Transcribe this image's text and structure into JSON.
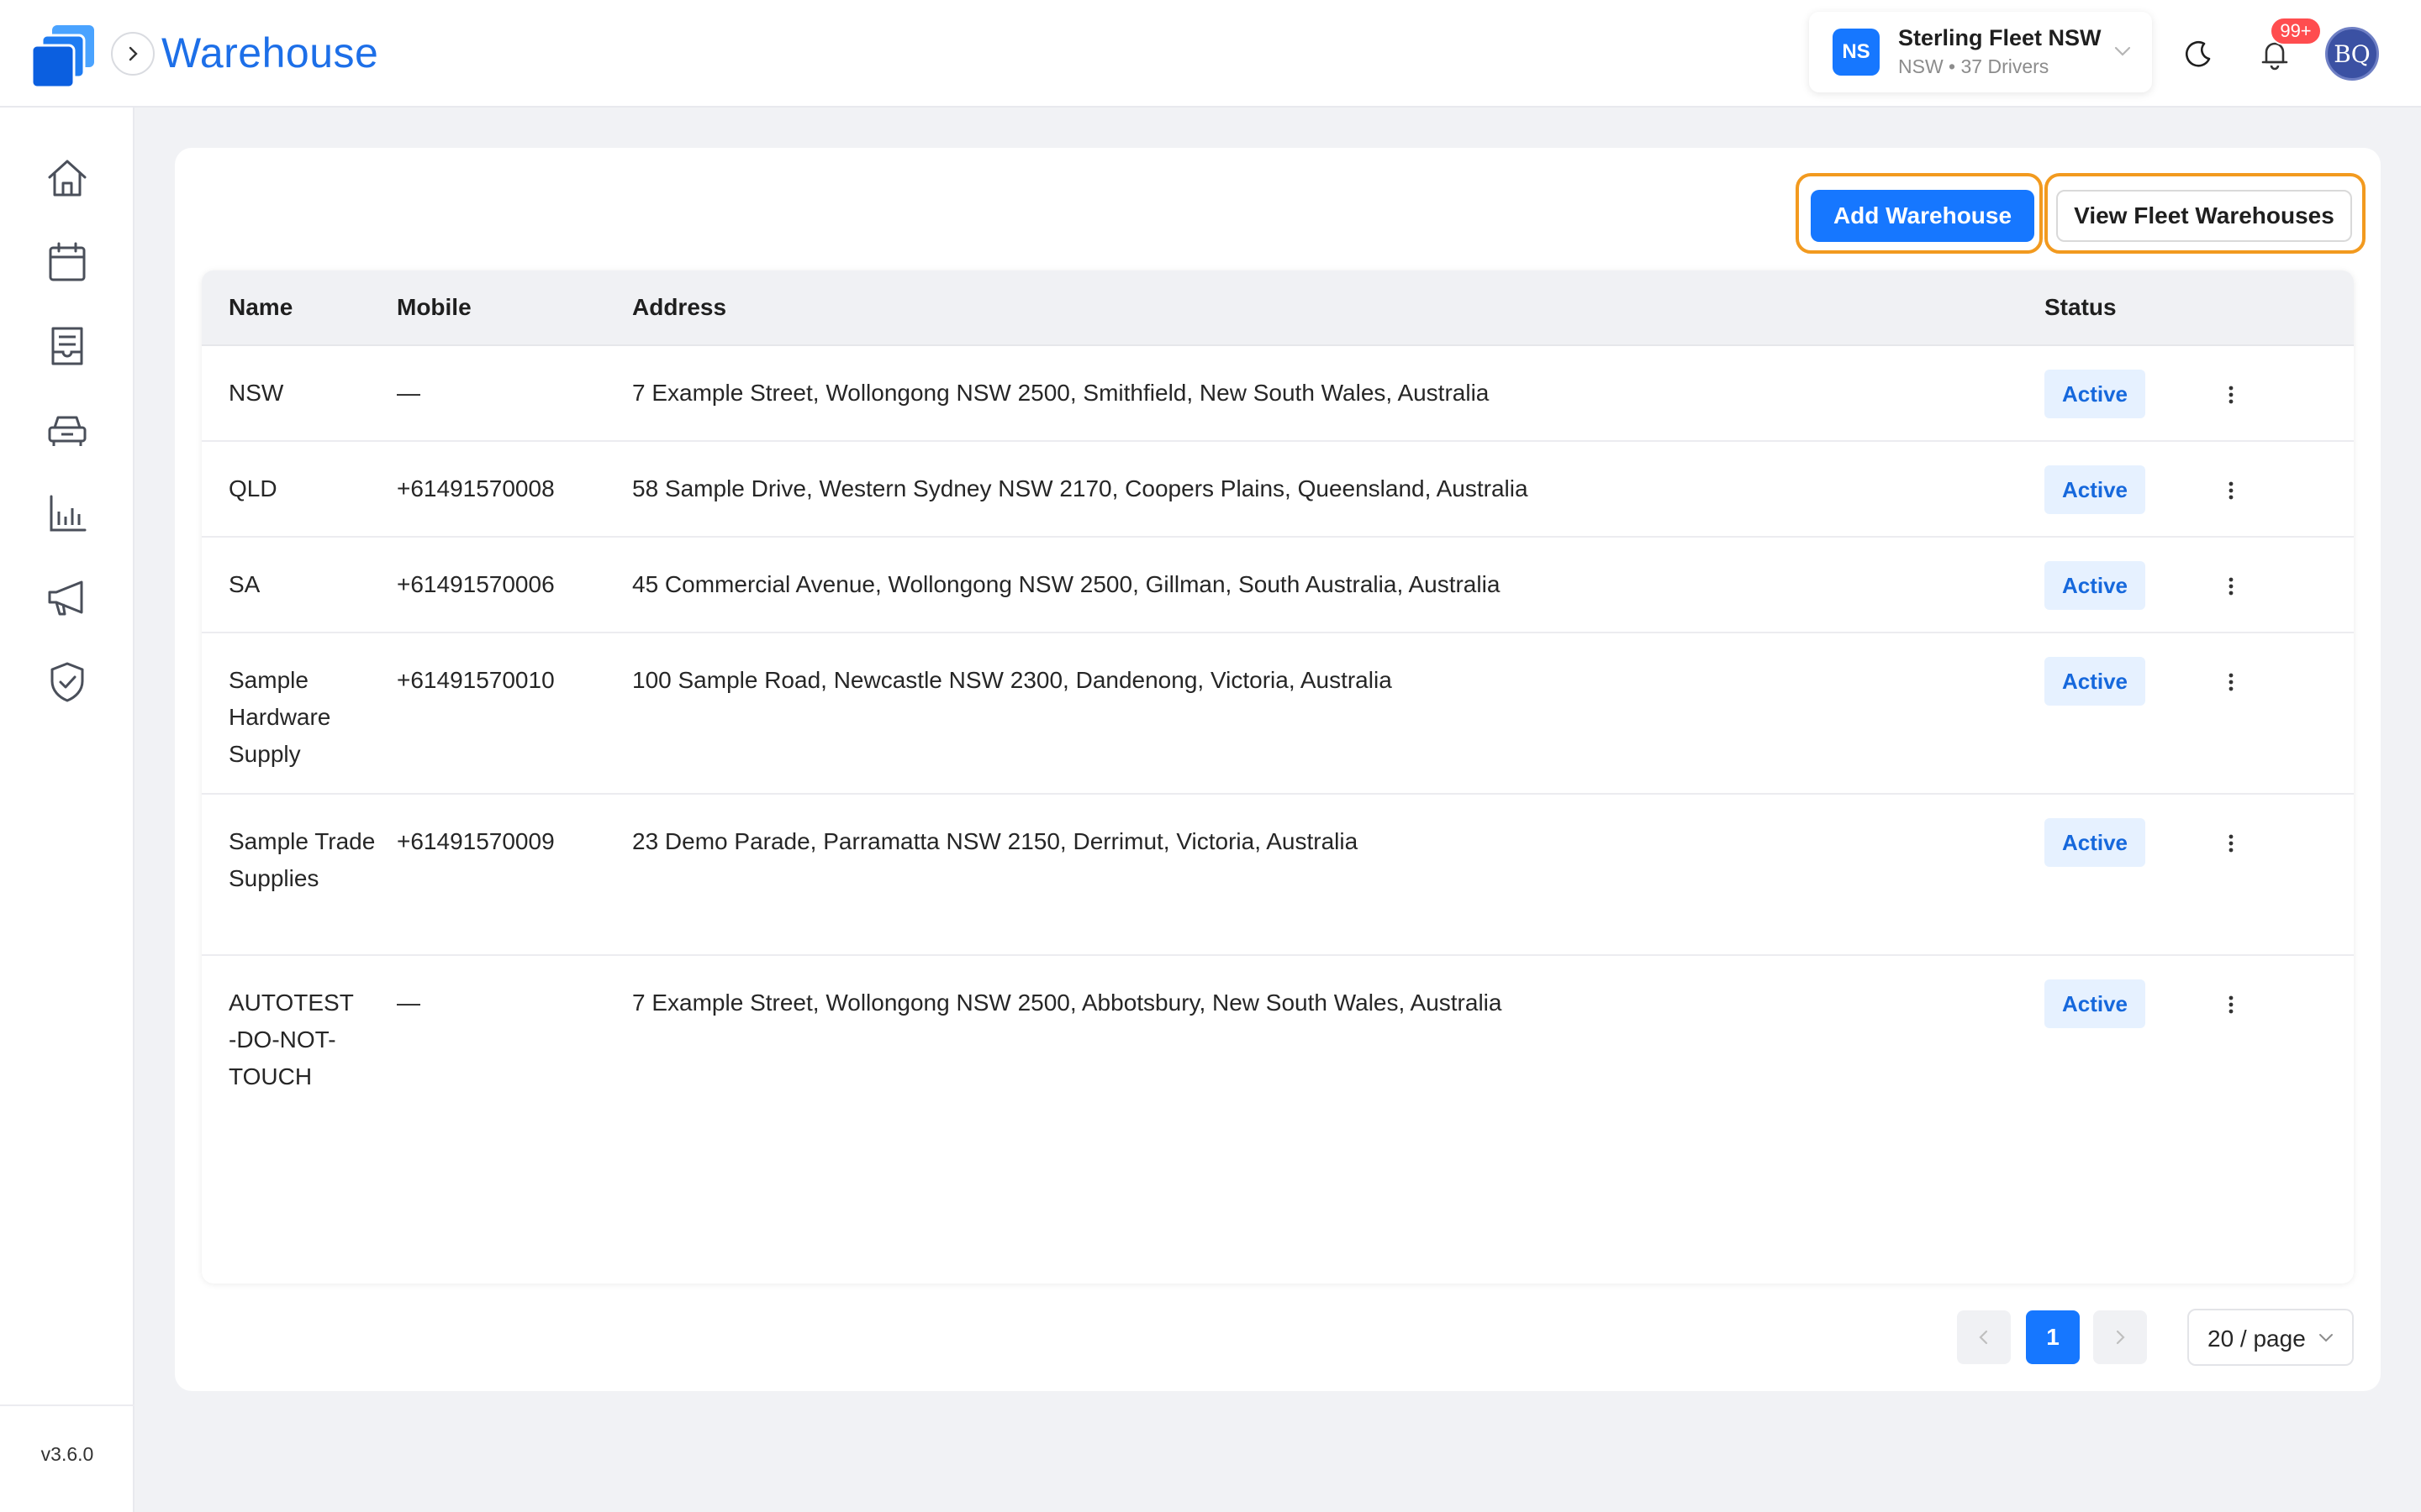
{
  "app": {
    "title": "Warehouse",
    "version": "v3.6.0"
  },
  "fleet": {
    "initials": "NS",
    "name": "Sterling Fleet NSW",
    "subtitle": "NSW • 37 Drivers"
  },
  "notifications": {
    "badge": "99+"
  },
  "user": {
    "initials": "BQ"
  },
  "sidebar": {
    "items": [
      {
        "icon": "home-icon"
      },
      {
        "icon": "calendar-icon"
      },
      {
        "icon": "orders-icon"
      },
      {
        "icon": "car-icon"
      },
      {
        "icon": "chart-icon"
      },
      {
        "icon": "megaphone-icon"
      },
      {
        "icon": "shield-check-icon"
      }
    ]
  },
  "toolbar": {
    "add_label": "Add Warehouse",
    "view_label": "View Fleet Warehouses"
  },
  "table": {
    "columns": [
      "Name",
      "Mobile",
      "Address",
      "Status"
    ],
    "rows": [
      {
        "name": "NSW",
        "mobile": "—",
        "address": "7 Example Street, Wollongong NSW 2500, Smithfield, New South Wales, Australia",
        "status": "Active"
      },
      {
        "name": "QLD",
        "mobile": "+61491570008",
        "address": "58 Sample Drive, Western Sydney NSW 2170, Coopers Plains, Queensland, Australia",
        "status": "Active"
      },
      {
        "name": "SA",
        "mobile": "+61491570006",
        "address": "45 Commercial Avenue, Wollongong NSW 2500, Gillman, South Australia, Australia",
        "status": "Active"
      },
      {
        "name": "Sample Hardware Supply",
        "mobile": "+61491570010",
        "address": "100 Sample Road, Newcastle NSW 2300, Dandenong, Victoria, Australia",
        "status": "Active"
      },
      {
        "name": "Sample Trade Supplies",
        "mobile": "+61491570009",
        "address": "23 Demo Parade, Parramatta NSW 2150, Derrimut, Victoria, Australia",
        "status": "Active"
      },
      {
        "name": "AUTOTEST -DO-NOT-TOUCH",
        "mobile": "—",
        "address": "7 Example Street, Wollongong NSW 2500, Abbotsbury, New South Wales, Australia",
        "status": "Active"
      }
    ]
  },
  "pagination": {
    "current": "1",
    "page_size": "20 / page"
  },
  "colors": {
    "primary": "#1677ff",
    "highlight": "#f29a1f",
    "status_bg": "#e6f1ff",
    "status_text": "#1668dc"
  }
}
